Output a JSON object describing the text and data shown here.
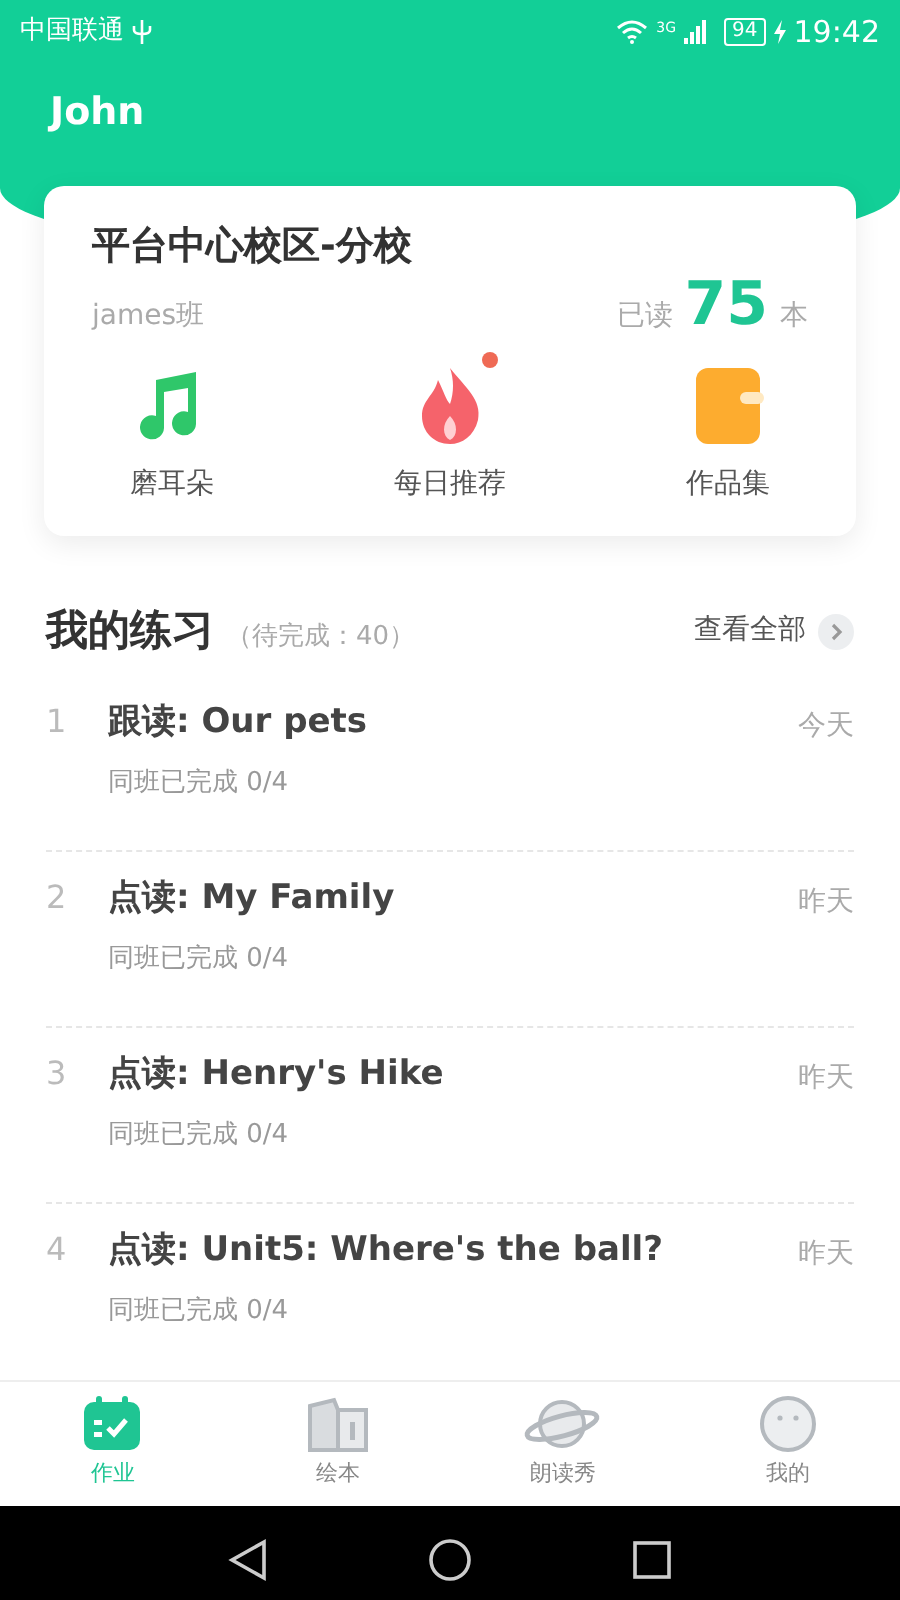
{
  "status_bar": {
    "carrier": "中国联通",
    "network": "3G",
    "battery": "94",
    "time": "19:42"
  },
  "header": {
    "title": "John"
  },
  "school_card": {
    "name": "平台中心校区-分校",
    "class_name": "james班",
    "read_label": "已读",
    "read_count": "75",
    "read_unit": "本",
    "features": [
      {
        "kind": "music",
        "label": "磨耳朵",
        "dot": false
      },
      {
        "kind": "fire",
        "label": "每日推荐",
        "dot": true
      },
      {
        "kind": "folder",
        "label": "作品集",
        "dot": false
      }
    ]
  },
  "practice": {
    "title": "我的练习",
    "pending": "（待完成：40）",
    "view_all": "查看全部",
    "items": [
      {
        "index": "1",
        "title": "跟读: Our pets",
        "progress": "同班已完成 0/4",
        "date": "今天"
      },
      {
        "index": "2",
        "title": "点读: My Family",
        "progress": "同班已完成 0/4",
        "date": "昨天"
      },
      {
        "index": "3",
        "title": "点读: Henry's Hike",
        "progress": "同班已完成 0/4",
        "date": "昨天"
      },
      {
        "index": "4",
        "title": "点读: Unit5: Where's the ball?",
        "progress": "同班已完成 0/4",
        "date": "昨天"
      }
    ]
  },
  "tab_bar": [
    {
      "kind": "homework",
      "label": "作业",
      "selected": true
    },
    {
      "kind": "book",
      "label": "绘本",
      "selected": false
    },
    {
      "kind": "planet",
      "label": "朗读秀",
      "selected": false
    },
    {
      "kind": "face",
      "label": "我的",
      "selected": false
    }
  ]
}
